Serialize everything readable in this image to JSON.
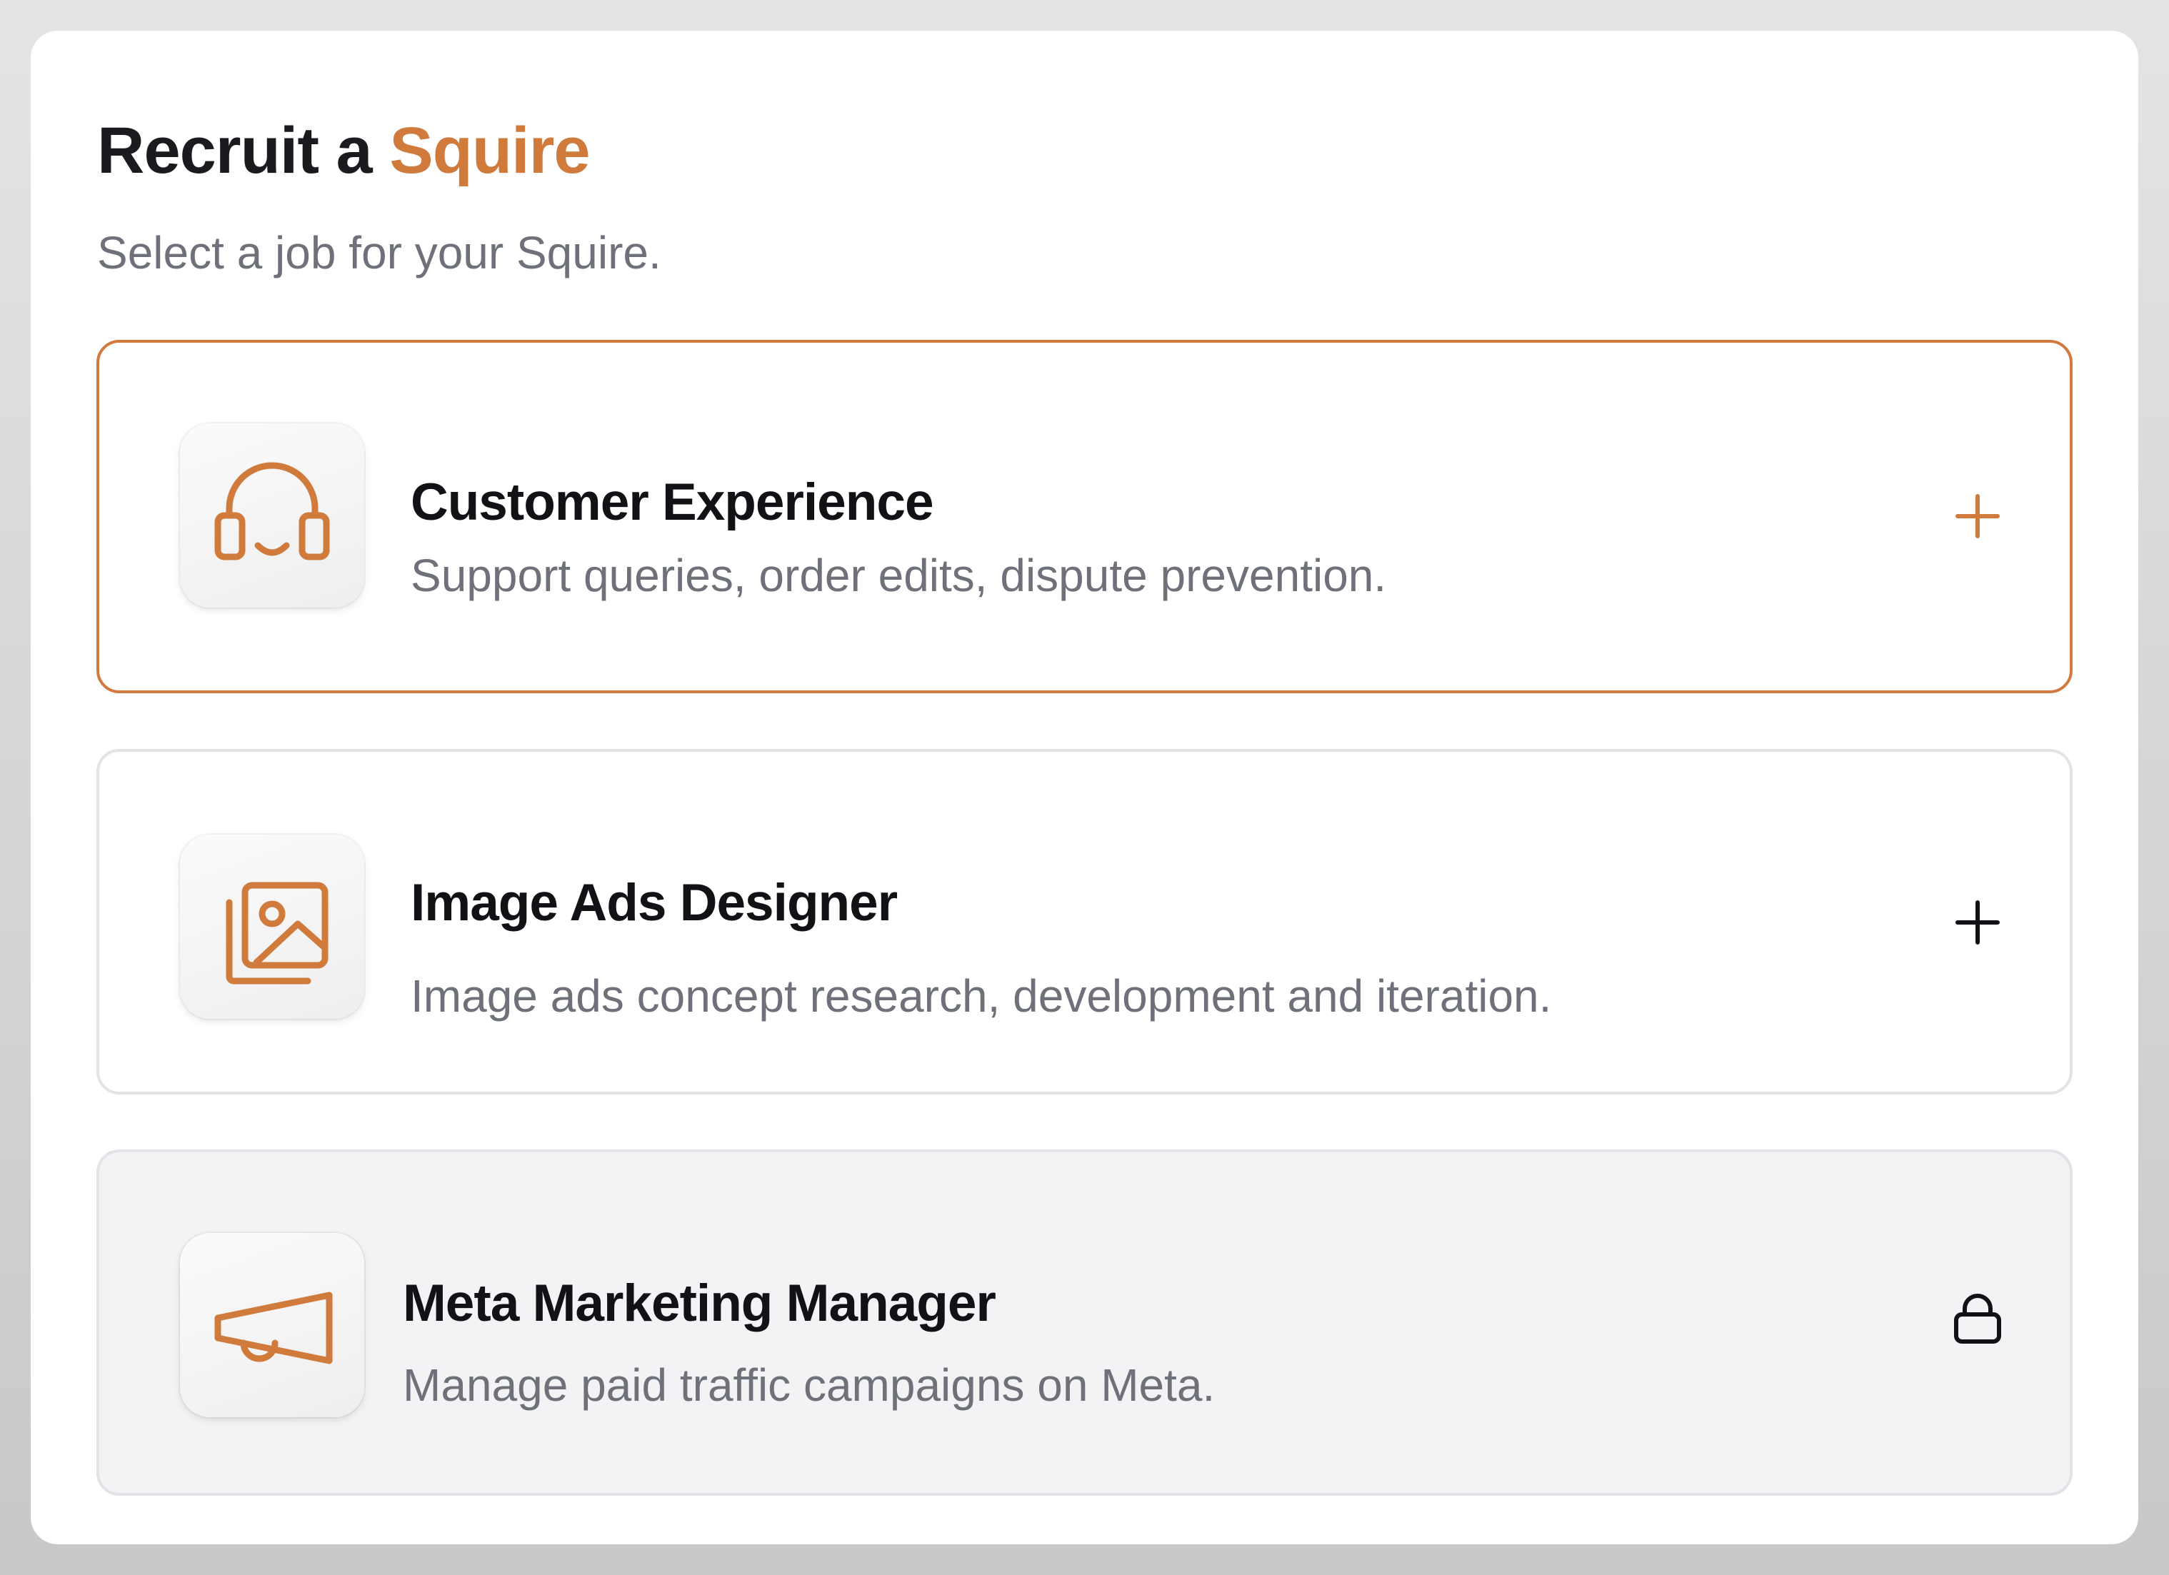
{
  "header": {
    "title_prefix": "Recruit a ",
    "title_accent": "Squire",
    "subtitle": "Select a job for your Squire."
  },
  "jobs": [
    {
      "title": "Customer Experience",
      "description": "Support queries, order edits, dispute prevention.",
      "icon": "headset-icon",
      "action": "add-icon",
      "state": "selected"
    },
    {
      "title": "Image Ads Designer",
      "description": "Image ads concept research, development and iteration.",
      "icon": "image-gallery-icon",
      "action": "add-icon",
      "state": "available"
    },
    {
      "title": "Meta Marketing Manager",
      "description": "Manage paid traffic campaigns on Meta.",
      "icon": "megaphone-icon",
      "action": "lock-icon",
      "state": "locked"
    }
  ],
  "colors": {
    "accent": "#d07a3c",
    "title_text": "#1b1b1f",
    "muted_text": "#6f717a",
    "locked_bg": "#f3f3f5"
  }
}
